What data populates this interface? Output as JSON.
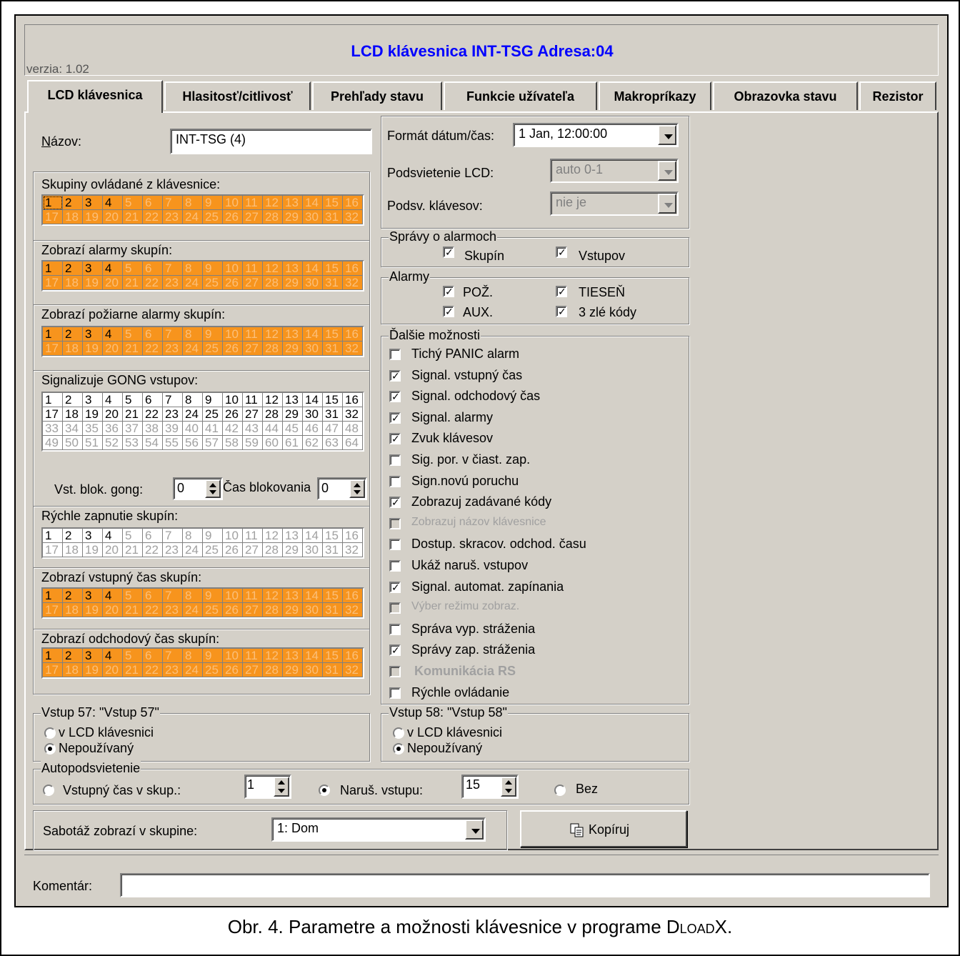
{
  "window": {
    "title": "LCD klávesnica INT-TSG Adresa:04",
    "version": "verzia: 1.02"
  },
  "tabs": [
    {
      "label": "LCD klávesnica"
    },
    {
      "label": "Hlasitosť/citlivosť"
    },
    {
      "label": "Prehľady stavu"
    },
    {
      "label": "Funkcie užívateľa"
    },
    {
      "label": "Makropríkazy"
    },
    {
      "label": "Obrazovka stavu"
    },
    {
      "label": "Rezistor"
    }
  ],
  "name_field": {
    "label": "Názov:",
    "value": "INT-TSG    (4)"
  },
  "zone_groups": [
    {
      "label": "Skupiny ovládané z klávesnice:",
      "style": "orange",
      "cells": [
        "1",
        "2",
        "3",
        "4",
        "5",
        "6",
        "7",
        "8",
        "9",
        "10",
        "11",
        "12",
        "13",
        "14",
        "15",
        "16",
        "17",
        "18",
        "19",
        "20",
        "21",
        "22",
        "23",
        "24",
        "25",
        "26",
        "27",
        "28",
        "29",
        "30",
        "31",
        "32"
      ],
      "active_count": 4
    },
    {
      "label": "Zobrazí alarmy skupín:",
      "style": "orange",
      "cells": [
        "1",
        "2",
        "3",
        "4",
        "5",
        "6",
        "7",
        "8",
        "9",
        "10",
        "11",
        "12",
        "13",
        "14",
        "15",
        "16",
        "17",
        "18",
        "19",
        "20",
        "21",
        "22",
        "23",
        "24",
        "25",
        "26",
        "27",
        "28",
        "29",
        "30",
        "31",
        "32"
      ],
      "active_count": 4
    },
    {
      "label": "Zobrazí požiarne alarmy skupín:",
      "style": "orange",
      "cells": [
        "1",
        "2",
        "3",
        "4",
        "5",
        "6",
        "7",
        "8",
        "9",
        "10",
        "11",
        "12",
        "13",
        "14",
        "15",
        "16",
        "17",
        "18",
        "19",
        "20",
        "21",
        "22",
        "23",
        "24",
        "25",
        "26",
        "27",
        "28",
        "29",
        "30",
        "31",
        "32"
      ],
      "active_count": 4
    },
    {
      "label": "Signalizuje GONG vstupov:",
      "style": "white",
      "cells": [
        "1",
        "2",
        "3",
        "4",
        "5",
        "6",
        "7",
        "8",
        "9",
        "10",
        "11",
        "12",
        "13",
        "14",
        "15",
        "16",
        "17",
        "18",
        "19",
        "20",
        "21",
        "22",
        "23",
        "24",
        "25",
        "26",
        "27",
        "28",
        "29",
        "30",
        "31",
        "32",
        "33",
        "34",
        "35",
        "36",
        "37",
        "38",
        "39",
        "40",
        "41",
        "42",
        "43",
        "44",
        "45",
        "46",
        "47",
        "48",
        "49",
        "50",
        "51",
        "52",
        "53",
        "54",
        "55",
        "56",
        "57",
        "58",
        "59",
        "60",
        "61",
        "62",
        "63",
        "64"
      ],
      "active_count": 32
    },
    {
      "label": "Rýchle zapnutie skupín:",
      "style": "white",
      "cells": [
        "1",
        "2",
        "3",
        "4",
        "5",
        "6",
        "7",
        "8",
        "9",
        "10",
        "11",
        "12",
        "13",
        "14",
        "15",
        "16",
        "17",
        "18",
        "19",
        "20",
        "21",
        "22",
        "23",
        "24",
        "25",
        "26",
        "27",
        "28",
        "29",
        "30",
        "31",
        "32"
      ],
      "active_count": 4
    },
    {
      "label": "Zobrazí vstupný čas skupín:",
      "style": "orange",
      "cells": [
        "1",
        "2",
        "3",
        "4",
        "5",
        "6",
        "7",
        "8",
        "9",
        "10",
        "11",
        "12",
        "13",
        "14",
        "15",
        "16",
        "17",
        "18",
        "19",
        "20",
        "21",
        "22",
        "23",
        "24",
        "25",
        "26",
        "27",
        "28",
        "29",
        "30",
        "31",
        "32"
      ],
      "active_count": 4
    },
    {
      "label": "Zobrazí odchodový čas skupín:",
      "style": "orange",
      "cells": [
        "1",
        "2",
        "3",
        "4",
        "5",
        "6",
        "7",
        "8",
        "9",
        "10",
        "11",
        "12",
        "13",
        "14",
        "15",
        "16",
        "17",
        "18",
        "19",
        "20",
        "21",
        "22",
        "23",
        "24",
        "25",
        "26",
        "27",
        "28",
        "29",
        "30",
        "31",
        "32"
      ],
      "active_count": 4
    }
  ],
  "gong_block": {
    "label": "Vst. blok. gong:",
    "value": "0",
    "time_label": "Čas blokovania",
    "time_value": "0"
  },
  "format": {
    "label": "Formát dátum/čas:",
    "value": "1 Jan, 12:00:00"
  },
  "lcd_backlight": {
    "label": "Podsvietenie LCD:",
    "value": "auto 0-1"
  },
  "key_backlight": {
    "label": "Podsv. klávesov:",
    "value": "nie je"
  },
  "alarm_msgs": {
    "title": "Správy o alarmoch",
    "items": [
      {
        "label": "Skupín",
        "checked": true
      },
      {
        "label": "Vstupov",
        "checked": true
      }
    ]
  },
  "alarms": {
    "title": "Alarmy",
    "items": [
      {
        "label": "POŽ.",
        "checked": true
      },
      {
        "label": "TIESEŇ",
        "checked": true
      },
      {
        "label": "AUX.",
        "checked": true
      },
      {
        "label": "3 zlé kódy",
        "checked": true
      }
    ]
  },
  "more_options": {
    "title": "Ďalšie možnosti",
    "items": [
      {
        "label": "Tichý PANIC alarm",
        "checked": false,
        "disabled": false
      },
      {
        "label": "Signal. vstupný čas",
        "checked": true,
        "disabled": false
      },
      {
        "label": "Signal. odchodový čas",
        "checked": true,
        "disabled": false
      },
      {
        "label": "Signal. alarmy",
        "checked": true,
        "disabled": false
      },
      {
        "label": "Zvuk klávesov",
        "checked": true,
        "disabled": false
      },
      {
        "label": "Sig. por. v čiast. zap.",
        "checked": false,
        "disabled": false
      },
      {
        "label": "Sign.novú poruchu",
        "checked": false,
        "disabled": false
      },
      {
        "label": "Zobrazuj zadávané kódy",
        "checked": true,
        "disabled": false
      },
      {
        "label": "Zobrazuj názov klávesnice",
        "checked": false,
        "disabled": true
      },
      {
        "label": "Dostup. skracov. odchod. času",
        "checked": false,
        "disabled": false
      },
      {
        "label": "Ukáž naruš. vstupov",
        "checked": false,
        "disabled": false
      },
      {
        "label": "Signal. automat. zapínania",
        "checked": true,
        "disabled": false
      },
      {
        "label": "Výber režimu zobraz.",
        "checked": false,
        "disabled": true
      },
      {
        "label": "Správa vyp. stráženia",
        "checked": false,
        "disabled": false
      },
      {
        "label": "Správy zap. stráženia",
        "checked": true,
        "disabled": false
      },
      {
        "label": "Komunikácia RS",
        "checked": false,
        "disabled": true
      },
      {
        "label": "Rýchle ovládanie",
        "checked": false,
        "disabled": false
      }
    ]
  },
  "input57": {
    "title": "Vstup 57: \"Vstup  57\"",
    "options": [
      {
        "label": "v LCD klávesnici",
        "selected": false
      },
      {
        "label": "Nepoužívaný",
        "selected": true
      }
    ]
  },
  "input58": {
    "title": "Vstup 58: \"Vstup  58\"",
    "options": [
      {
        "label": "v LCD klávesnici",
        "selected": false
      },
      {
        "label": "Nepoužívaný",
        "selected": true
      }
    ]
  },
  "autobacklight": {
    "title": "Autopodsvietenie",
    "opt1": {
      "label": "Vstupný čas v skup.:",
      "selected": false,
      "value": "1"
    },
    "opt2": {
      "label": "Naruš. vstupu:",
      "selected": true,
      "value": "15"
    },
    "opt3": {
      "label": "Bez",
      "selected": false
    }
  },
  "tamper": {
    "label": "Sabotáž zobrazí v skupine:",
    "value": "1: Dom"
  },
  "copy_button": {
    "label": "Kopíruj",
    "icon": "copy-icon"
  },
  "comment": {
    "label": "Komentár:",
    "value": ""
  },
  "caption": {
    "prefix": "Obr. 4. Parametre a možnosti klávesnice v programe ",
    "program": "DloadX",
    "suffix": "."
  }
}
